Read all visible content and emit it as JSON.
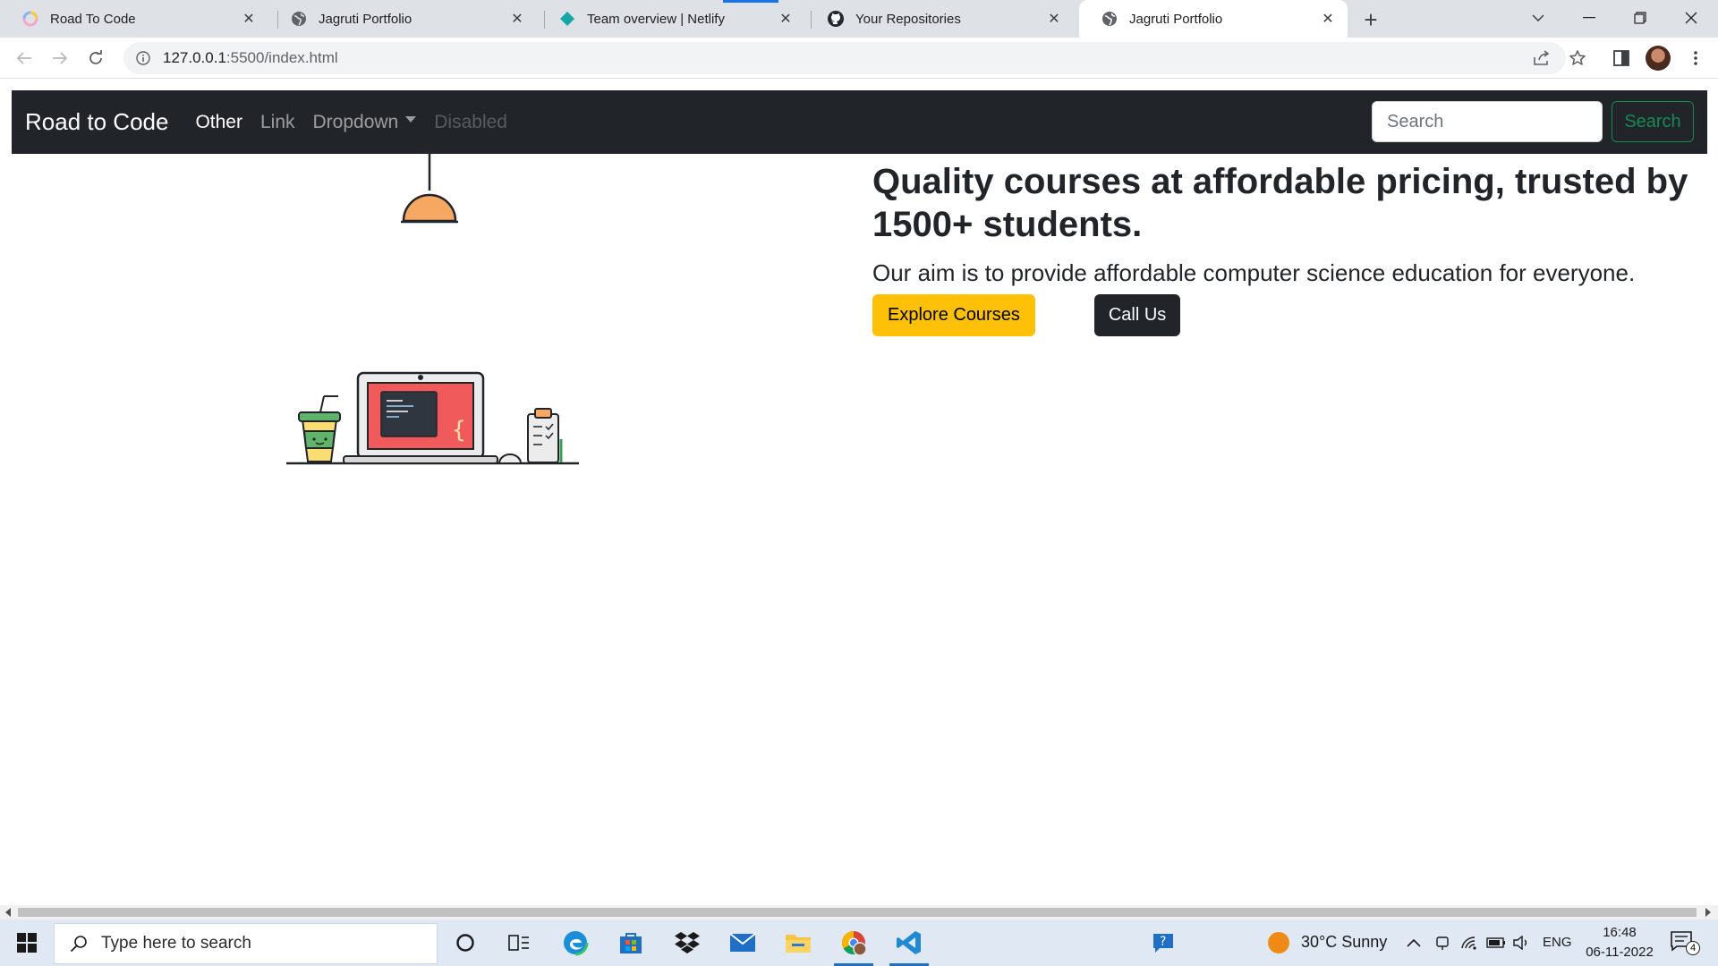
{
  "browser": {
    "tabs": [
      {
        "title": "Road To Code",
        "favicon": "loading-ring-icon",
        "active": false
      },
      {
        "title": "Jagruti Portfolio",
        "favicon": "globe-icon",
        "active": false
      },
      {
        "title": "Team overview | Netlify",
        "favicon": "netlify-icon",
        "active": false
      },
      {
        "title": "Your Repositories",
        "favicon": "github-icon",
        "active": false
      },
      {
        "title": "Jagruti Portfolio",
        "favicon": "globe-icon",
        "active": true
      }
    ],
    "address": {
      "host": "127.0.0.1",
      "path": ":5500/index.html"
    }
  },
  "site": {
    "brand": "Road to Code",
    "nav": {
      "other": "Other",
      "link": "Link",
      "dropdown": "Dropdown",
      "disabled": "Disabled"
    },
    "search": {
      "placeholder": "Search",
      "button": "Search"
    },
    "hero": {
      "title": "Quality courses at affordable pricing, trusted by 1500+ students.",
      "subtitle": "Our aim is to provide affordable computer science education for everyone.",
      "explore_button": "Explore Courses",
      "call_button": "Call Us",
      "illustration": "desk-laptop-illustration"
    },
    "colors": {
      "navbar": "#212529",
      "explore": "#ffc107",
      "search_outline": "#198754"
    }
  },
  "taskbar": {
    "search_placeholder": "Type here to search",
    "weather": "30°C  Sunny",
    "language": "ENG",
    "time": "16:48",
    "date": "06-11-2022",
    "notification_count": "4"
  }
}
